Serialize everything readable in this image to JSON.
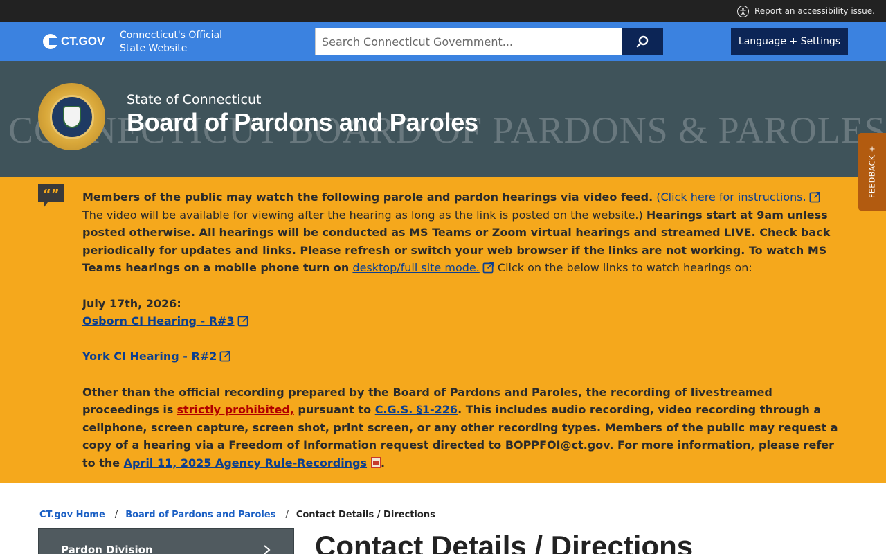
{
  "a11y": {
    "link_label": "Report an accessibility issue."
  },
  "header": {
    "logo_text": "CT.GOV",
    "tagline_line1": "Connecticut's Official",
    "tagline_line2": "State Website",
    "search_placeholder": "Search Connecticut Government...",
    "language_label": "Language + Settings"
  },
  "banner": {
    "state_label": "State of Connecticut",
    "agency_title": "Board of Pardons and Paroles",
    "watermark": "CONNECTICUT BOARD OF PARDONS & PAROLES",
    "feedback_label": "FEEDBACK +"
  },
  "alert": {
    "intro_bold": "Members of the public may watch the following parole and pardon hearings via video feed.",
    "instructions_link": "(Click here for instructions.",
    "video_note": " The video will be available for viewing after the hearing as long as the link is posted on the website.)",
    "hearings_bold": " Hearings start at 9am unless posted otherwise. All hearings will be conducted as MS Teams or Zoom virtual hearings and streamed LIVE. Check back periodically for updates and links. Please refresh or switch your web browser if the links are not working. To watch MS Teams hearings on a mobile phone turn on",
    "desktop_link": "desktop/full site mode.",
    "watch_text": " Click on the below links to watch hearings on:",
    "date_label": "July 17th, 2026:",
    "hearing1": "Osborn CI Hearing - R#3",
    "hearing2": "York CI Hearing - R#2",
    "recording_bold1": "Other than the official recording prepared by the Board of Pardons and Paroles, the recording of livestreamed proceedings is",
    "prohibited_link": "strictly prohibited,",
    "recording_bold2": " pursuant to ",
    "cgs_link": "C.G.S. §1-226",
    "recording_bold3": ". This includes audio recording, video recording through a cellphone, screen capture, screen shot, print screen, or any other recording types. Members of the public may request a copy of a hearing via a Freedom of Information request directed to BOPPFOI@ct.gov. For more information, please refer to the ",
    "rule_link": "April 11, 2025 Agency Rule-Recordings",
    "period": "."
  },
  "breadcrumb": {
    "home": "CT.gov Home",
    "agency": "Board of Pardons and Paroles",
    "current": "Contact Details / Directions",
    "separator": "/"
  },
  "side_nav": {
    "items": [
      {
        "label": "Pardon Division"
      }
    ]
  },
  "main": {
    "heading": "Contact Details / Directions"
  },
  "colors": {
    "header_blue": "#3b82e0",
    "navy": "#0c2556",
    "alert_orange": "#f5a81c",
    "banner_slate": "#3f535a",
    "feedback": "#b25b10"
  }
}
